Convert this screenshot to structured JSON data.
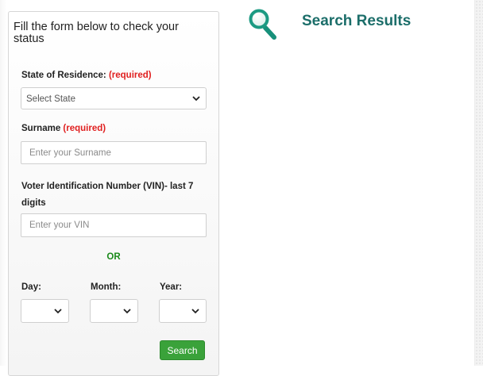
{
  "form": {
    "intro": "Fill the form below to check your status",
    "state": {
      "label": "State of Residence:",
      "required": "(required)",
      "selected": "Select State"
    },
    "surname": {
      "label": "Surname",
      "required": "(required)",
      "value": "",
      "placeholder": "Enter your Surname"
    },
    "vin": {
      "label": "Voter Identification Number (VIN)- last 7 digits",
      "value": "",
      "placeholder": "Enter your VIN"
    },
    "or_text": "OR",
    "dob": {
      "day_label": "Day:",
      "month_label": "Month:",
      "year_label": "Year:",
      "day_selected": "",
      "month_selected": "",
      "year_selected": ""
    },
    "search_label": "Search"
  },
  "results": {
    "title": "Search Results",
    "icon": "magnifier-icon"
  },
  "colors": {
    "accent_green": "#3aa23a",
    "required_red": "#e02020",
    "or_green": "#1a8a1a",
    "title_teal": "#1c6e6a"
  }
}
